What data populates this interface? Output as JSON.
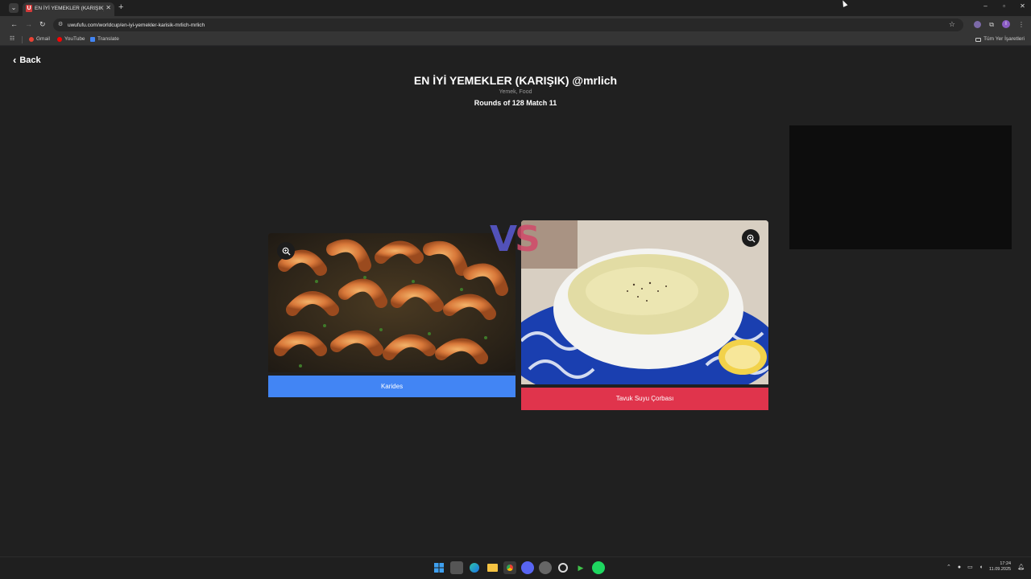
{
  "browser": {
    "tab": {
      "favicon_letter": "U",
      "title": "EN İYİ YEMEKLER (KARIŞIK) @mr..."
    },
    "new_tab": "+",
    "tab_close": "✕",
    "window_controls": {
      "minimize": "–",
      "maximize": "▫",
      "close": "✕"
    },
    "url": "uwufufu.com/worldcup/en-iyi-yemekler-karisik-mrlich-mrlich",
    "bookmarks": [
      {
        "label": "Gmail",
        "color": "#ea4335"
      },
      {
        "label": "YouTube",
        "color": "#ff0000"
      },
      {
        "label": "Translate",
        "color": "#4285f4"
      }
    ],
    "all_bookmarks": "Tüm Yer İşaretleri",
    "profile_letter": "I"
  },
  "page": {
    "back_label": "Back",
    "title": "EN İYİ YEMEKLER (KARIŞIK) @mrlich",
    "tags": "Yemek, Food",
    "rounds": "Rounds of 128 Match 11",
    "vs_v": "V",
    "vs_s": "S",
    "left_choice": {
      "label": "Karides",
      "button_color": "#4285f4"
    },
    "right_choice": {
      "label": "Tavuk Suyu Çorbası",
      "button_color": "#e0344c"
    }
  },
  "taskbar": {
    "time": "17:24",
    "date": "11.09.2025",
    "apps": [
      "windows-start",
      "task-view",
      "edge",
      "file-explorer",
      "chrome",
      "discord",
      "obs",
      "chatgpt",
      "media-player",
      "spotify"
    ]
  }
}
